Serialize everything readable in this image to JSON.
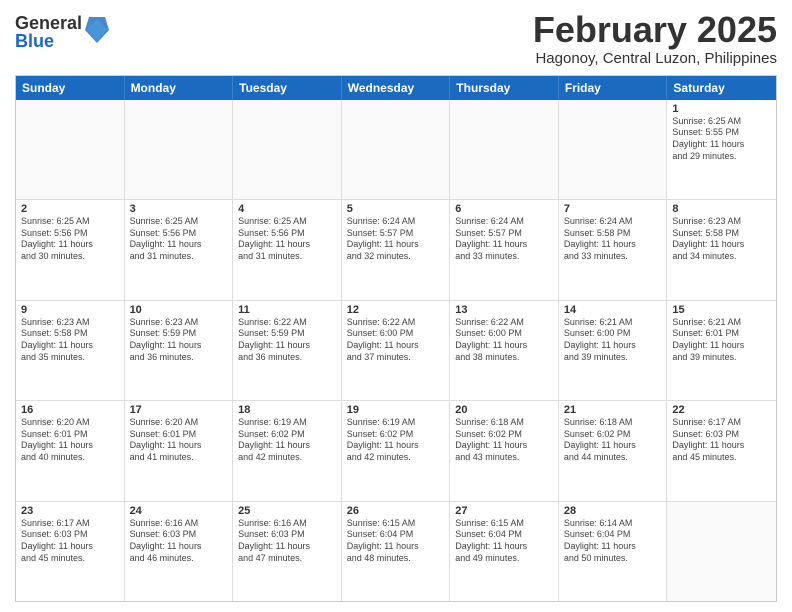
{
  "logo": {
    "general": "General",
    "blue": "Blue"
  },
  "title": "February 2025",
  "subtitle": "Hagonoy, Central Luzon, Philippines",
  "header_days": [
    "Sunday",
    "Monday",
    "Tuesday",
    "Wednesday",
    "Thursday",
    "Friday",
    "Saturday"
  ],
  "weeks": [
    [
      {
        "day": "",
        "info": ""
      },
      {
        "day": "",
        "info": ""
      },
      {
        "day": "",
        "info": ""
      },
      {
        "day": "",
        "info": ""
      },
      {
        "day": "",
        "info": ""
      },
      {
        "day": "",
        "info": ""
      },
      {
        "day": "1",
        "info": "Sunrise: 6:25 AM\nSunset: 5:55 PM\nDaylight: 11 hours\nand 29 minutes."
      }
    ],
    [
      {
        "day": "2",
        "info": "Sunrise: 6:25 AM\nSunset: 5:56 PM\nDaylight: 11 hours\nand 30 minutes."
      },
      {
        "day": "3",
        "info": "Sunrise: 6:25 AM\nSunset: 5:56 PM\nDaylight: 11 hours\nand 31 minutes."
      },
      {
        "day": "4",
        "info": "Sunrise: 6:25 AM\nSunset: 5:56 PM\nDaylight: 11 hours\nand 31 minutes."
      },
      {
        "day": "5",
        "info": "Sunrise: 6:24 AM\nSunset: 5:57 PM\nDaylight: 11 hours\nand 32 minutes."
      },
      {
        "day": "6",
        "info": "Sunrise: 6:24 AM\nSunset: 5:57 PM\nDaylight: 11 hours\nand 33 minutes."
      },
      {
        "day": "7",
        "info": "Sunrise: 6:24 AM\nSunset: 5:58 PM\nDaylight: 11 hours\nand 33 minutes."
      },
      {
        "day": "8",
        "info": "Sunrise: 6:23 AM\nSunset: 5:58 PM\nDaylight: 11 hours\nand 34 minutes."
      }
    ],
    [
      {
        "day": "9",
        "info": "Sunrise: 6:23 AM\nSunset: 5:58 PM\nDaylight: 11 hours\nand 35 minutes."
      },
      {
        "day": "10",
        "info": "Sunrise: 6:23 AM\nSunset: 5:59 PM\nDaylight: 11 hours\nand 36 minutes."
      },
      {
        "day": "11",
        "info": "Sunrise: 6:22 AM\nSunset: 5:59 PM\nDaylight: 11 hours\nand 36 minutes."
      },
      {
        "day": "12",
        "info": "Sunrise: 6:22 AM\nSunset: 6:00 PM\nDaylight: 11 hours\nand 37 minutes."
      },
      {
        "day": "13",
        "info": "Sunrise: 6:22 AM\nSunset: 6:00 PM\nDaylight: 11 hours\nand 38 minutes."
      },
      {
        "day": "14",
        "info": "Sunrise: 6:21 AM\nSunset: 6:00 PM\nDaylight: 11 hours\nand 39 minutes."
      },
      {
        "day": "15",
        "info": "Sunrise: 6:21 AM\nSunset: 6:01 PM\nDaylight: 11 hours\nand 39 minutes."
      }
    ],
    [
      {
        "day": "16",
        "info": "Sunrise: 6:20 AM\nSunset: 6:01 PM\nDaylight: 11 hours\nand 40 minutes."
      },
      {
        "day": "17",
        "info": "Sunrise: 6:20 AM\nSunset: 6:01 PM\nDaylight: 11 hours\nand 41 minutes."
      },
      {
        "day": "18",
        "info": "Sunrise: 6:19 AM\nSunset: 6:02 PM\nDaylight: 11 hours\nand 42 minutes."
      },
      {
        "day": "19",
        "info": "Sunrise: 6:19 AM\nSunset: 6:02 PM\nDaylight: 11 hours\nand 42 minutes."
      },
      {
        "day": "20",
        "info": "Sunrise: 6:18 AM\nSunset: 6:02 PM\nDaylight: 11 hours\nand 43 minutes."
      },
      {
        "day": "21",
        "info": "Sunrise: 6:18 AM\nSunset: 6:02 PM\nDaylight: 11 hours\nand 44 minutes."
      },
      {
        "day": "22",
        "info": "Sunrise: 6:17 AM\nSunset: 6:03 PM\nDaylight: 11 hours\nand 45 minutes."
      }
    ],
    [
      {
        "day": "23",
        "info": "Sunrise: 6:17 AM\nSunset: 6:03 PM\nDaylight: 11 hours\nand 45 minutes."
      },
      {
        "day": "24",
        "info": "Sunrise: 6:16 AM\nSunset: 6:03 PM\nDaylight: 11 hours\nand 46 minutes."
      },
      {
        "day": "25",
        "info": "Sunrise: 6:16 AM\nSunset: 6:03 PM\nDaylight: 11 hours\nand 47 minutes."
      },
      {
        "day": "26",
        "info": "Sunrise: 6:15 AM\nSunset: 6:04 PM\nDaylight: 11 hours\nand 48 minutes."
      },
      {
        "day": "27",
        "info": "Sunrise: 6:15 AM\nSunset: 6:04 PM\nDaylight: 11 hours\nand 49 minutes."
      },
      {
        "day": "28",
        "info": "Sunrise: 6:14 AM\nSunset: 6:04 PM\nDaylight: 11 hours\nand 50 minutes."
      },
      {
        "day": "",
        "info": ""
      }
    ]
  ]
}
